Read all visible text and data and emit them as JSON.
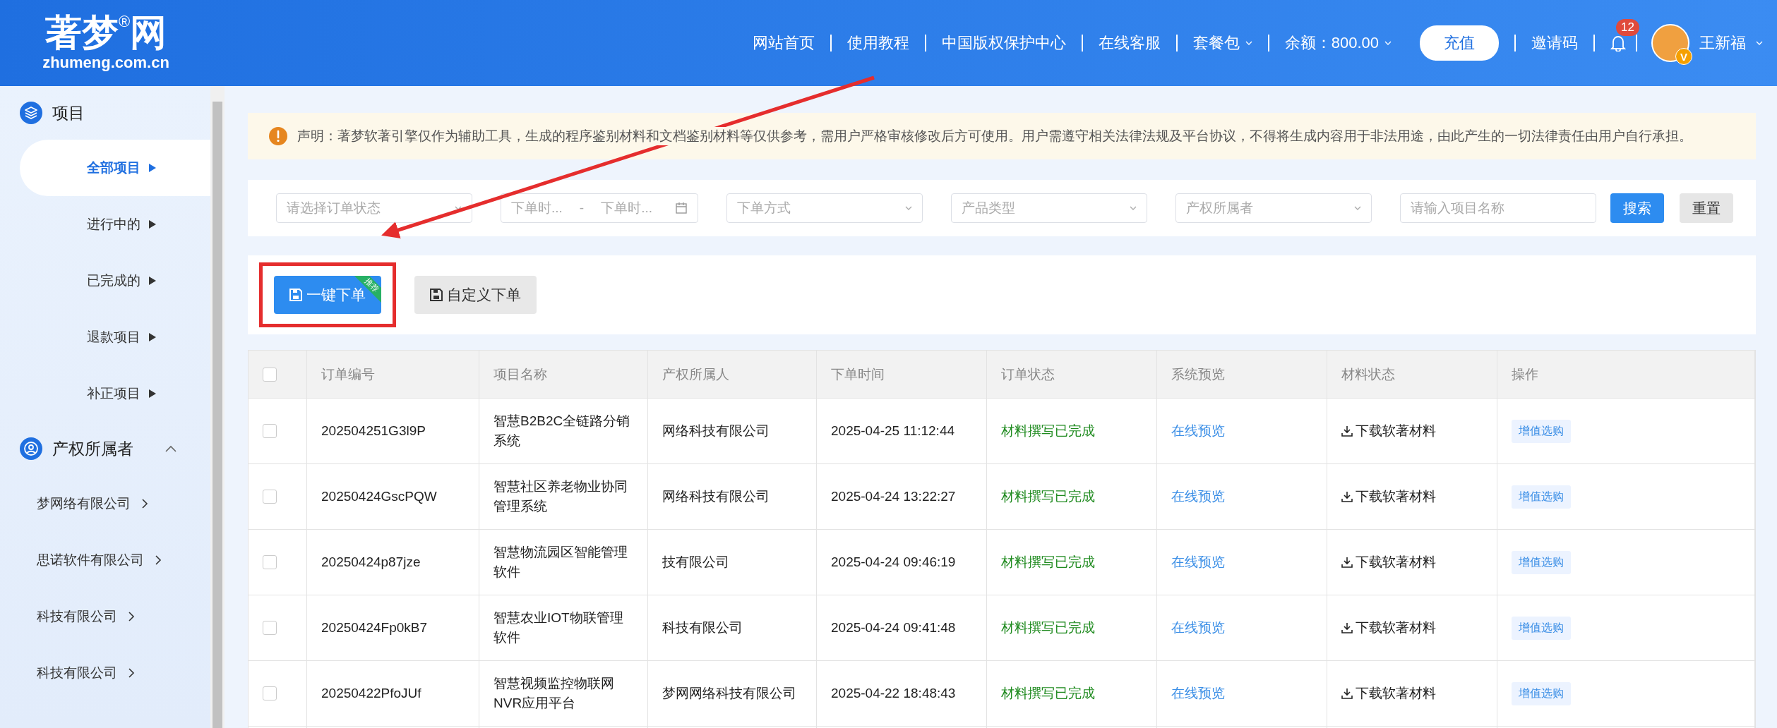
{
  "header": {
    "logo": {
      "name": "著梦",
      "mark": "®",
      "suffix": "网",
      "domain": "zhumeng.com.cn"
    },
    "nav": [
      {
        "kind": "link",
        "label": "网站首页"
      },
      {
        "kind": "link",
        "label": "使用教程"
      },
      {
        "kind": "link",
        "label": "中国版权保护中心"
      },
      {
        "kind": "link",
        "label": "在线客服"
      },
      {
        "kind": "dropdown",
        "label": "套餐包"
      },
      {
        "kind": "dropdown",
        "label": "余额：800.00"
      },
      {
        "kind": "button",
        "label": "充值"
      },
      {
        "kind": "link",
        "label": "邀请码"
      }
    ],
    "notification_count": "12",
    "user": {
      "badge": "V",
      "name": "王新福"
    }
  },
  "sidebar": {
    "sections": [
      {
        "kind": "projects",
        "title": "项目",
        "expanded": true,
        "items": [
          {
            "label": "全部项目",
            "selected": true
          },
          {
            "label": "进行中的",
            "selected": false
          },
          {
            "label": "已完成的",
            "selected": false
          },
          {
            "label": "退款项目",
            "selected": false
          },
          {
            "label": "补正项目",
            "selected": false
          }
        ]
      },
      {
        "kind": "owners",
        "title": "产权所属者",
        "expanded": true,
        "items": [
          {
            "label": "梦网络有限公司",
            "selected": false
          },
          {
            "label": "思诺软件有限公司",
            "selected": false
          },
          {
            "label": "科技有限公司",
            "selected": false
          },
          {
            "label": "科技有限公司",
            "selected": false
          }
        ]
      }
    ]
  },
  "notice": "声明：著梦软著引擎仅作为辅助工具，生成的程序鉴别材料和文档鉴别材料等仅供参考，需用户严格审核修改后方可使用。用户需遵守相关法律法规及平台协议，不得将生成内容用于非法用途，由此产生的一切法律责任由用户自行承担。",
  "filters": [
    {
      "kind": "select",
      "placeholder": "请选择订单状态"
    },
    {
      "kind": "daterange",
      "start_placeholder": "下单时...",
      "separator": "-",
      "end_placeholder": "下单时..."
    },
    {
      "kind": "select",
      "placeholder": "下单方式"
    },
    {
      "kind": "select",
      "placeholder": "产品类型"
    },
    {
      "kind": "select",
      "placeholder": "产权所属者"
    },
    {
      "kind": "input",
      "placeholder": "请输入项目名称"
    }
  ],
  "filter_buttons": [
    {
      "label": "搜索",
      "primary": true
    },
    {
      "label": "重置",
      "primary": false
    }
  ],
  "actions": [
    {
      "label": "一键下单",
      "primary": true,
      "badge": "推荐",
      "highlighted": true
    },
    {
      "label": "自定义下单",
      "primary": false,
      "highlighted": false
    }
  ],
  "table": {
    "columns": [
      "订单编号",
      "项目名称",
      "产权所属人",
      "下单时间",
      "订单状态",
      "系统预览",
      "材料状态",
      "操作"
    ],
    "header_checked": false,
    "rows": [
      {
        "checked": false,
        "id": "202504251G3l9P",
        "name": "智慧B2B2C全链路分销系统",
        "owner": "网络科技有限公司",
        "time": "2025-04-25 11:12:44",
        "status": "材料撰写已完成",
        "preview": "在线预览",
        "material": "下载软著材料",
        "action": "增值选购"
      },
      {
        "checked": false,
        "id": "20250424GscPQW",
        "name": "智慧社区养老物业协同管理系统",
        "owner": "网络科技有限公司",
        "time": "2025-04-24 13:22:27",
        "status": "材料撰写已完成",
        "preview": "在线预览",
        "material": "下载软著材料",
        "action": "增值选购"
      },
      {
        "checked": false,
        "id": "20250424p87jze",
        "name": "智慧物流园区智能管理软件",
        "owner": "技有限公司",
        "time": "2025-04-24 09:46:19",
        "status": "材料撰写已完成",
        "preview": "在线预览",
        "material": "下载软著材料",
        "action": "增值选购"
      },
      {
        "checked": false,
        "id": "20250424Fp0kB7",
        "name": "智慧农业IOT物联管理软件",
        "owner": "科技有限公司",
        "time": "2025-04-24 09:41:48",
        "status": "材料撰写已完成",
        "preview": "在线预览",
        "material": "下载软著材料",
        "action": "增值选购"
      },
      {
        "checked": false,
        "id": "20250422PfoJUf",
        "name": "智慧视频监控物联网NVR应用平台",
        "owner": "梦网网络科技有限公司",
        "time": "2025-04-22 18:48:43",
        "status": "材料撰写已完成",
        "preview": "在线预览",
        "material": "下载软著材料",
        "action": "增值选购"
      }
    ]
  }
}
